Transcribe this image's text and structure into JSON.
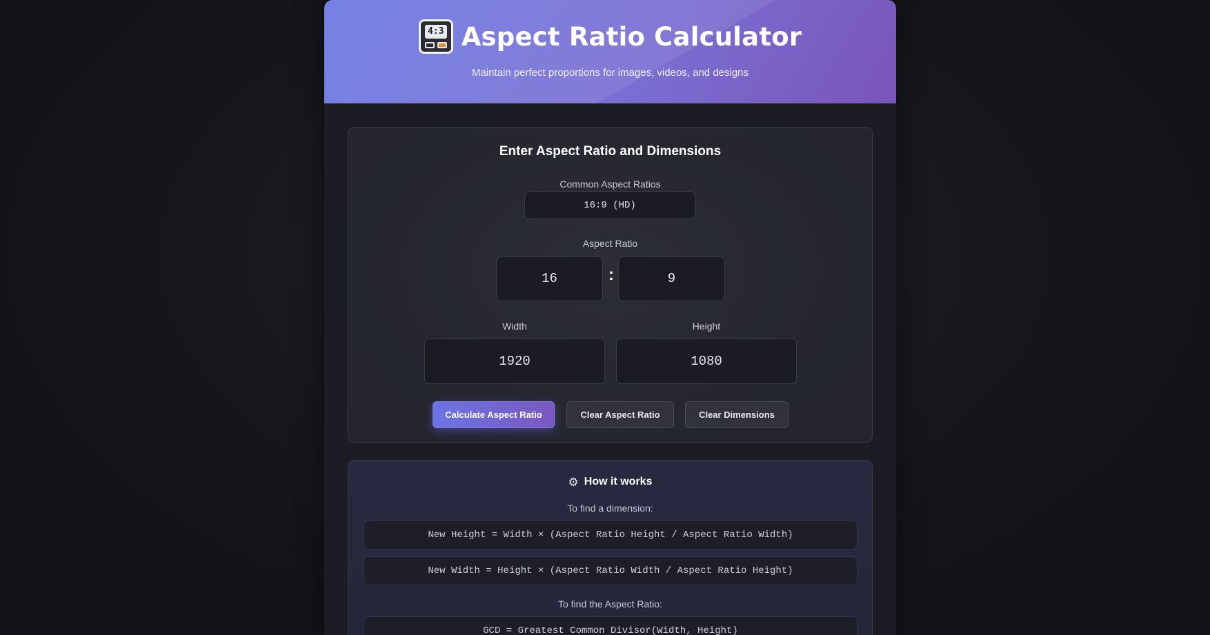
{
  "header": {
    "icon": "aspect-ratio-calculator-icon",
    "icon_text": "4:3",
    "title": "Aspect Ratio Calculator",
    "subtitle": "Maintain perfect proportions for images, videos, and designs"
  },
  "calculator": {
    "title": "Enter Aspect Ratio and Dimensions",
    "common_label": "Common Aspect Ratios",
    "common_value": "16:9 (HD)",
    "ratio_label": "Aspect Ratio",
    "ratio_width": "16",
    "ratio_separator": ":",
    "ratio_height": "9",
    "width_label": "Width",
    "width_value": "1920",
    "height_label": "Height",
    "height_value": "1080",
    "buttons": {
      "calculate": "Calculate Aspect Ratio",
      "clear_ratio": "Clear Aspect Ratio",
      "clear_dimensions": "Clear Dimensions"
    }
  },
  "how_it_works": {
    "icon": "gear-icon",
    "title": "How it works",
    "find_dimension_label": "To find a dimension:",
    "formula_height": "New Height = Width × (Aspect Ratio Height / Aspect Ratio Width)",
    "formula_width": "New Width = Height × (Aspect Ratio Width / Aspect Ratio Height)",
    "find_ratio_label": "To find the Aspect Ratio:",
    "formula_gcd": "GCD = Greatest Common Divisor(Width, Height)"
  },
  "colors": {
    "accent_start": "#6b74e4",
    "accent_end": "#7a58c0",
    "background": "#15161a",
    "panel": "#1c1d24"
  }
}
